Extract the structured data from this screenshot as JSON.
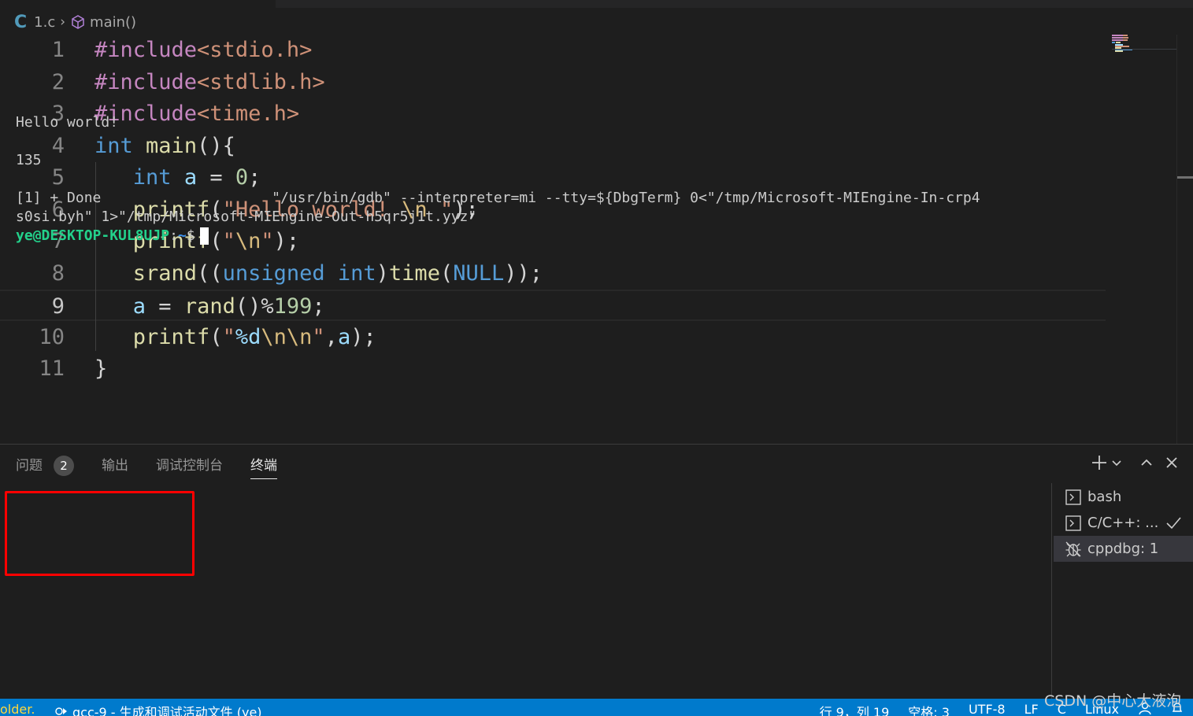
{
  "breadcrumb": {
    "file_icon": "C",
    "file": "1.c",
    "symbol": "main()"
  },
  "editor": {
    "line_numbers": [
      "1",
      "2",
      "3",
      "4",
      "5",
      "6",
      "7",
      "8",
      "9",
      "10",
      "11"
    ],
    "current_line": 9,
    "lines": [
      [
        {
          "t": "#include",
          "c": "pre"
        },
        {
          "t": "<stdio.h>",
          "c": "str"
        }
      ],
      [
        {
          "t": "#include",
          "c": "pre"
        },
        {
          "t": "<stdlib.h>",
          "c": "str"
        }
      ],
      [
        {
          "t": "#include",
          "c": "pre"
        },
        {
          "t": "<time.h>",
          "c": "str"
        }
      ],
      [
        {
          "t": "int",
          "c": "kw"
        },
        {
          "t": " ",
          "c": "pl"
        },
        {
          "t": "main",
          "c": "fn"
        },
        {
          "t": "(){",
          "c": "pl"
        }
      ],
      [
        {
          "t": "   ",
          "c": "pl"
        },
        {
          "t": "int",
          "c": "kw"
        },
        {
          "t": " ",
          "c": "pl"
        },
        {
          "t": "a",
          "c": "var"
        },
        {
          "t": " = ",
          "c": "pl"
        },
        {
          "t": "0",
          "c": "num"
        },
        {
          "t": ";",
          "c": "pl"
        }
      ],
      [
        {
          "t": "   ",
          "c": "pl"
        },
        {
          "t": "printf",
          "c": "fn"
        },
        {
          "t": "(",
          "c": "pl"
        },
        {
          "t": "\"Hello world! ",
          "c": "str"
        },
        {
          "t": "\\n",
          "c": "esc"
        },
        {
          "t": " \"",
          "c": "str"
        },
        {
          "t": ");",
          "c": "pl"
        }
      ],
      [
        {
          "t": "   ",
          "c": "pl"
        },
        {
          "t": "printf",
          "c": "fn"
        },
        {
          "t": "(",
          "c": "pl"
        },
        {
          "t": "\"",
          "c": "str"
        },
        {
          "t": "\\n",
          "c": "esc"
        },
        {
          "t": "\"",
          "c": "str"
        },
        {
          "t": ");",
          "c": "pl"
        }
      ],
      [
        {
          "t": "   ",
          "c": "pl"
        },
        {
          "t": "srand",
          "c": "fn"
        },
        {
          "t": "((",
          "c": "pl"
        },
        {
          "t": "unsigned int",
          "c": "kw"
        },
        {
          "t": ")",
          "c": "pl"
        },
        {
          "t": "time",
          "c": "fn"
        },
        {
          "t": "(",
          "c": "pl"
        },
        {
          "t": "NULL",
          "c": "kw"
        },
        {
          "t": "));",
          "c": "pl"
        }
      ],
      [
        {
          "t": "   ",
          "c": "pl"
        },
        {
          "t": "a",
          "c": "var"
        },
        {
          "t": " = ",
          "c": "pl"
        },
        {
          "t": "rand",
          "c": "fn"
        },
        {
          "t": "()%",
          "c": "pl"
        },
        {
          "t": "199",
          "c": "num"
        },
        {
          "t": ";",
          "c": "pl"
        }
      ],
      [
        {
          "t": "   ",
          "c": "pl"
        },
        {
          "t": "printf",
          "c": "fn"
        },
        {
          "t": "(",
          "c": "pl"
        },
        {
          "t": "\"",
          "c": "str"
        },
        {
          "t": "%d",
          "c": "fmt"
        },
        {
          "t": "\\n\\n",
          "c": "esc"
        },
        {
          "t": "\"",
          "c": "str"
        },
        {
          "t": ",",
          "c": "pl"
        },
        {
          "t": "a",
          "c": "var"
        },
        {
          "t": ");",
          "c": "pl"
        }
      ],
      [
        {
          "t": "}",
          "c": "pl"
        }
      ]
    ]
  },
  "panel": {
    "tabs": [
      {
        "label": "问题",
        "badge": "2"
      },
      {
        "label": "输出"
      },
      {
        "label": "调试控制台"
      },
      {
        "label": "终端",
        "active": true
      }
    ],
    "actions": [
      "plus-icon",
      "chevron-down-icon",
      "maximize-icon",
      "close-icon"
    ]
  },
  "terminal": {
    "lines": [
      "Hello world!",
      "",
      "135",
      "",
      "[1] + Done                    \"/usr/bin/gdb\" --interpreter=mi --tty=${DbgTerm} 0<\"/tmp/Microsoft-MIEngine-In-crp4",
      "s0si.byh\" 1>\"/tmp/Microsoft-MIEngine-Out-h5qr5j1t.yyz\""
    ],
    "prompt_user": "ye@DESKTOP-KUL8UJP",
    "prompt_sep": ":",
    "prompt_path": "~",
    "prompt_symbol": "$"
  },
  "terminal_list": [
    {
      "label": "bash",
      "icon": "terminal-icon"
    },
    {
      "label": "C/C++: ...",
      "icon": "terminal-icon",
      "check": true
    },
    {
      "label": "cppdbg: 1",
      "icon": "debug-icon",
      "selected": true
    }
  ],
  "statusbar": {
    "folder": "older.",
    "task": "gcc-9 - 生成和调试活动文件 (ye)",
    "position": "行 9，列 19",
    "spaces": "空格: 3",
    "encoding": "UTF-8",
    "eol": "LF",
    "language": "C",
    "platform": "Linux"
  },
  "watermark": "CSDN @中心大液泡",
  "colors": {
    "background": "#1e1e1e",
    "statusbar": "#007acc",
    "highlight_box": "#ff0000",
    "prompt_user": "#23d18b",
    "prompt_path": "#3b8eea"
  }
}
